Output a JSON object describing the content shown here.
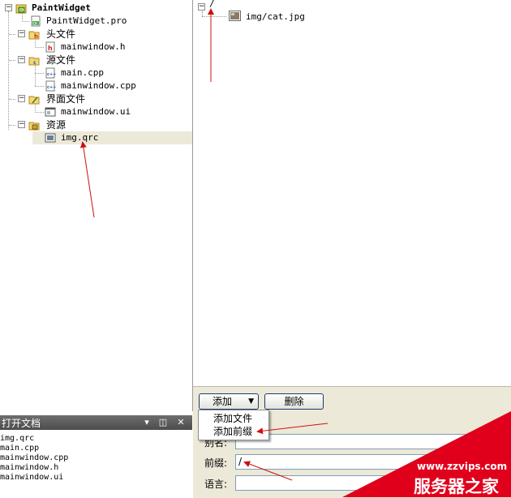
{
  "project_tree": {
    "root": "PaintWidget",
    "pro_file": "PaintWidget.pro",
    "headers_label": "头文件",
    "headers": [
      "mainwindow.h"
    ],
    "sources_label": "源文件",
    "sources": [
      "main.cpp",
      "mainwindow.cpp"
    ],
    "forms_label": "界面文件",
    "forms": [
      "mainwindow.ui"
    ],
    "resources_label": "资源",
    "resources": [
      "img.qrc"
    ]
  },
  "open_docs": {
    "title": "打开文档",
    "items": [
      "img.qrc",
      "main.cpp",
      "mainwindow.cpp",
      "mainwindow.h",
      "mainwindow.ui"
    ]
  },
  "resource_editor": {
    "prefix_node": "/",
    "files": [
      "img/cat.jpg"
    ]
  },
  "controls": {
    "add_button": "添加",
    "delete_button": "删除",
    "add_menu": [
      "添加文件",
      "添加前缀"
    ],
    "alias_label": "别名:",
    "prefix_label": "前缀:",
    "prefix_value": "/",
    "language_label": "语言:",
    "language_value": ""
  },
  "watermark": {
    "url": "www.zzvips.com",
    "brand": "服务器之家"
  },
  "colors": {
    "selection": "#ece9d8",
    "panel_bg": "#ece9d8",
    "arrow": "#cc1111",
    "watermark_red": "#e0001b"
  }
}
